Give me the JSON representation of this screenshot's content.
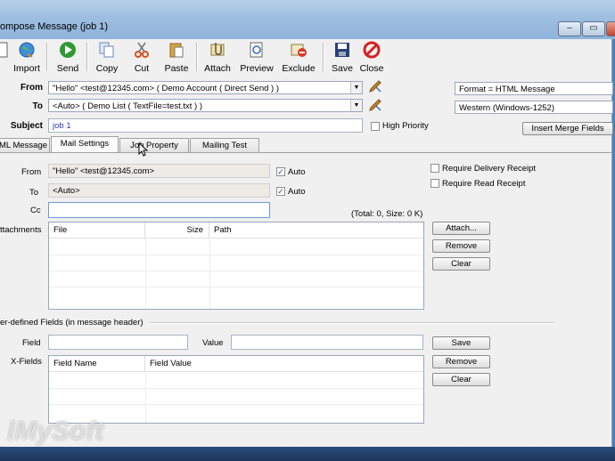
{
  "window": {
    "title": "ompose Message (job 1)",
    "minimize": "–",
    "maximize": "▭",
    "close": "✕"
  },
  "toolbar": [
    {
      "label": "",
      "icon": "new-icon"
    },
    {
      "label": "Import",
      "icon": "globe-icon"
    },
    {
      "label": "Send",
      "icon": "send-icon"
    },
    {
      "label": "Copy",
      "icon": "copy-icon"
    },
    {
      "label": "Cut",
      "icon": "scissors-icon"
    },
    {
      "label": "Paste",
      "icon": "paste-icon"
    },
    {
      "label": "Attach",
      "icon": "attach-icon"
    },
    {
      "label": "Preview",
      "icon": "preview-icon"
    },
    {
      "label": "Exclude",
      "icon": "exclude-icon"
    },
    {
      "label": "Save",
      "icon": "save-icon"
    },
    {
      "label": "Close",
      "icon": "close-icon"
    }
  ],
  "header": {
    "from_label": "From",
    "from_value": "\"Hello\" <test@12345.com> ( Demo Account ( Direct Send ) )",
    "to_label": "To",
    "to_value": "<Auto> ( Demo List ( TextFile=test.txt ) )",
    "subject_label": "Subject",
    "subject_value": "job 1",
    "high_priority": "High Priority",
    "format_value": "Format = HTML Message",
    "encoding_value": "Western (Windows-1252)",
    "insert_merge": "Insert Merge Fields"
  },
  "tabs": [
    {
      "label": "ML Message",
      "active": false
    },
    {
      "label": "Mail Settings",
      "active": true
    },
    {
      "label": "Job Property",
      "active": false
    },
    {
      "label": "Mailing Test",
      "active": false
    }
  ],
  "mail_settings": {
    "from_label": "From",
    "from_value": "\"Hello\" <test@12345.com>",
    "to_label": "To",
    "to_value": "<Auto>",
    "cc_label": "Cc",
    "cc_value": "",
    "auto_label": "Auto",
    "delivery_receipt": "Require Delivery Receipt",
    "read_receipt": "Require Read Receipt",
    "total": "(Total: 0, Size: 0 K)",
    "attachments_label": "ttachments",
    "attach_cols": [
      "File",
      "Size",
      "Path"
    ],
    "attach_btn": "Attach...",
    "remove_btn": "Remove",
    "clear_btn": "Clear",
    "user_fields_label": "er-defined Fields (in message header)",
    "field_label": "Field",
    "value_label": "Value",
    "xfields_label": "X-Fields",
    "xfield_cols": [
      "Field Name",
      "Field Value"
    ],
    "save_btn": "Save",
    "remove2_btn": "Remove",
    "clear2_btn": "Clear"
  },
  "watermark": "lMySoft",
  "colors": {
    "accent": "#2a4d7c",
    "send_green": "#2f9a33",
    "close_red": "#d62020"
  }
}
